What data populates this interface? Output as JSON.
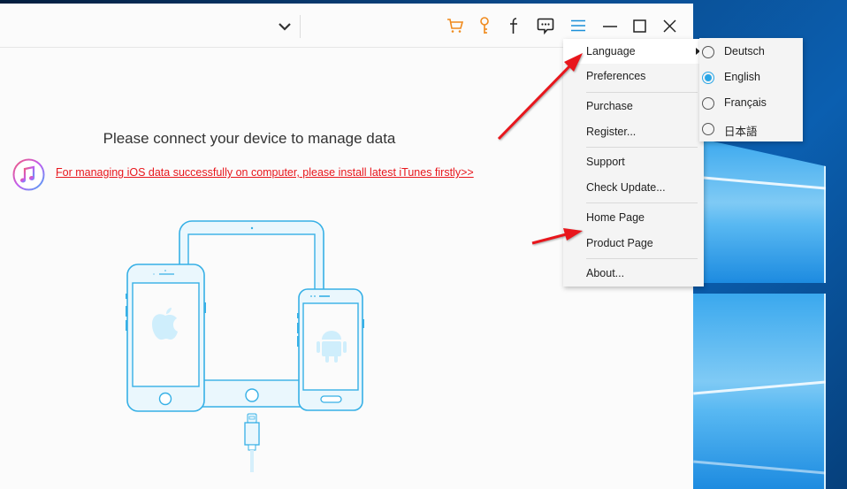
{
  "window": {
    "title_bar": {
      "device_dropdown_icon": "chevron-down-icon",
      "icons": [
        {
          "name": "cart-icon",
          "color": "#f08a1c"
        },
        {
          "name": "key-icon",
          "color": "#f08a1c"
        },
        {
          "name": "facebook-icon",
          "color": "#222222"
        },
        {
          "name": "feedback-icon",
          "color": "#222222"
        },
        {
          "name": "menu-icon",
          "color": "#1a8fd8"
        },
        {
          "name": "minimize-icon",
          "color": "#222222"
        },
        {
          "name": "maximize-icon",
          "color": "#222222"
        },
        {
          "name": "close-icon",
          "color": "#222222"
        }
      ]
    }
  },
  "main": {
    "title": "Please connect your device to manage data",
    "itunes_link": "For managing iOS data successfully on computer, please install latest iTunes firstly>>",
    "link_color": "#e8161c",
    "illustration_color": "#36b0e6"
  },
  "menu": {
    "items": [
      {
        "label": "Language",
        "has_submenu": true
      },
      {
        "label": "Preferences"
      },
      {
        "label": "Purchase"
      },
      {
        "label": "Register..."
      },
      {
        "label": "Support"
      },
      {
        "label": "Check Update..."
      },
      {
        "label": "Home Page"
      },
      {
        "label": "Product Page"
      },
      {
        "label": "About..."
      }
    ]
  },
  "language_submenu": {
    "selected": "English",
    "options": [
      {
        "label": "Deutsch",
        "checked": false
      },
      {
        "label": "English",
        "checked": true
      },
      {
        "label": "Français",
        "checked": false
      },
      {
        "label": "日本語",
        "checked": false
      }
    ]
  },
  "annotations": {
    "arrow_color": "#e8161c",
    "arrows": [
      {
        "points_to": "Language"
      },
      {
        "points_to": "Product Page"
      }
    ]
  }
}
